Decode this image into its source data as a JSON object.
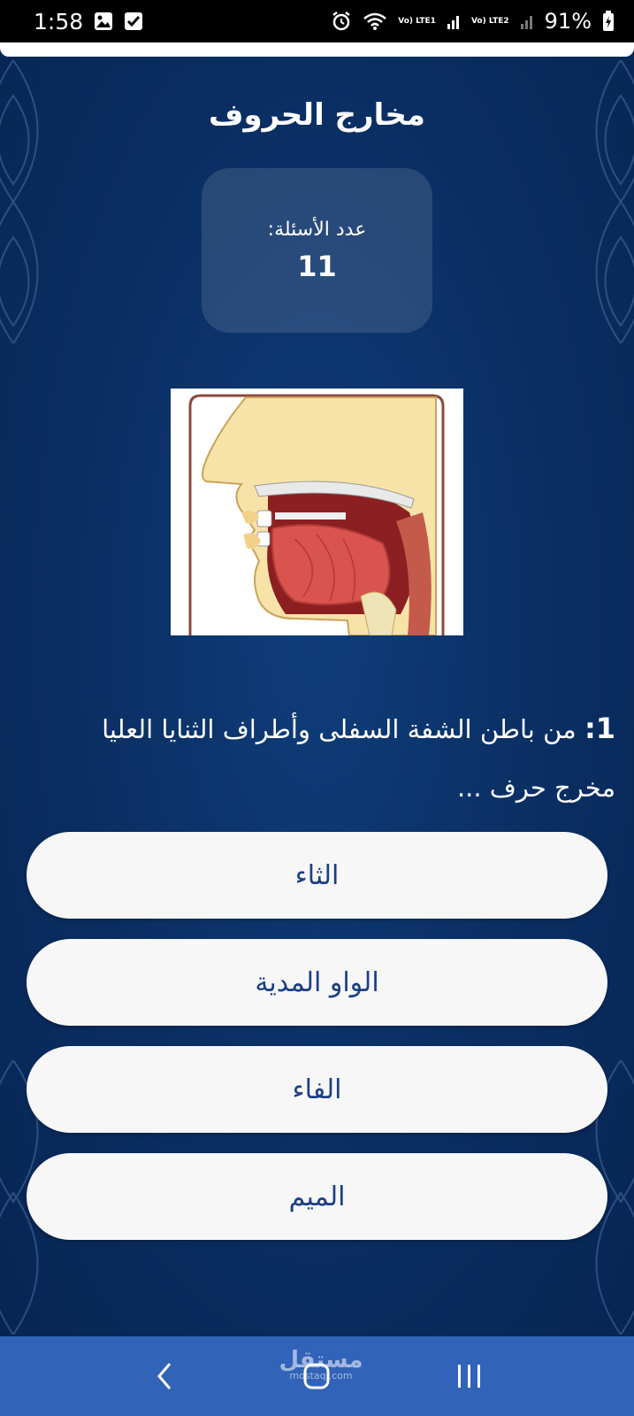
{
  "status": {
    "time": "1:58",
    "sim1": "Vo) LTE1",
    "sim2": "Vo) LTE2",
    "battery": "91%"
  },
  "app": {
    "title": "مخارج الحروف",
    "question_count_label": "عدد الأسئلة:",
    "question_count": "11"
  },
  "question": {
    "number": "1:",
    "text": "من باطن الشفة السفلى وأطراف الثنايا العليا مخرج حرف ..."
  },
  "answers": [
    {
      "label": "الثاء"
    },
    {
      "label": "الواو المدية"
    },
    {
      "label": "الفاء"
    },
    {
      "label": "الميم"
    }
  ],
  "watermark": {
    "brand": "مستقل",
    "domain": "mostaql.com"
  },
  "colors": {
    "background": "#0b2f63",
    "answer_text": "#1b3f85",
    "nav_bar": "#3163b8"
  }
}
